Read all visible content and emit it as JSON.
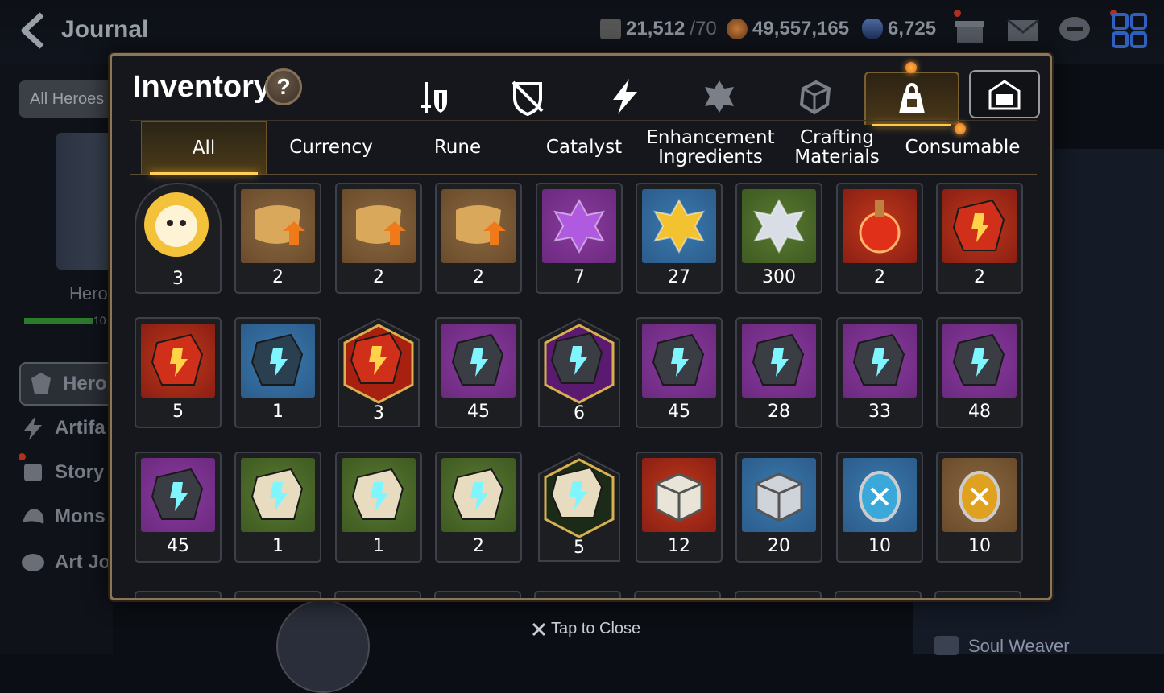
{
  "header": {
    "title": "Journal",
    "stamina": "21,512",
    "stamina_max": "/70",
    "gold": "49,557,165",
    "crystal": "6,725"
  },
  "left_nav": {
    "filter_label": "All Heroes",
    "hero_label": "Hero",
    "hero_progress": "10",
    "items": [
      {
        "label": "Hero",
        "icon": "hero-icon"
      },
      {
        "label": "Artifa",
        "icon": "lightning-icon"
      },
      {
        "label": "Story",
        "icon": "scroll-icon"
      },
      {
        "label": "Mons",
        "icon": "monster-icon"
      },
      {
        "label": "Art Jo",
        "icon": "palette-icon"
      }
    ]
  },
  "right_panel": {
    "item_label": "Soul Weaver"
  },
  "modal": {
    "title": "Inventory",
    "help_label": "?",
    "categories": [
      {
        "icon": "weapon-armor-icon"
      },
      {
        "icon": "broken-shield-icon"
      },
      {
        "icon": "lightning-icon"
      },
      {
        "icon": "rune-gear-icon"
      },
      {
        "icon": "material-cube-icon"
      },
      {
        "icon": "bag-icon",
        "active": true
      }
    ],
    "exchange_icon": "exchange-shop-icon",
    "subtabs": [
      "All",
      "Currency",
      "Rune",
      "Catalyst",
      "Enhancement\nIngredients",
      "Crafting\nMaterials",
      "Consumable"
    ],
    "active_subtab": "All",
    "items": [
      {
        "name": "phantasma-coin",
        "count": "3"
      },
      {
        "name": "rainbow-scroll",
        "count": "2"
      },
      {
        "name": "upgrade-scroll-a",
        "count": "2"
      },
      {
        "name": "upgrade-scroll-b",
        "count": "2"
      },
      {
        "name": "purple-crystal-flower",
        "count": "7"
      },
      {
        "name": "gold-crystal-flower",
        "count": "27"
      },
      {
        "name": "silver-crystal-flower",
        "count": "300"
      },
      {
        "name": "red-potion",
        "count": "2"
      },
      {
        "name": "red-stone-slash",
        "count": "2"
      },
      {
        "name": "red-stone-hammer",
        "count": "5"
      },
      {
        "name": "blue-rune-hammer",
        "count": "1"
      },
      {
        "name": "red-hex-stone-star",
        "count": "3"
      },
      {
        "name": "purple-stone-wing",
        "count": "45"
      },
      {
        "name": "purple-hex-stone-star",
        "count": "6"
      },
      {
        "name": "purple-stone-armor",
        "count": "45"
      },
      {
        "name": "purple-stone-slash",
        "count": "28"
      },
      {
        "name": "purple-stone-hammer",
        "count": "33"
      },
      {
        "name": "purple-stone-sword",
        "count": "48"
      },
      {
        "name": "purple-stone-boot",
        "count": "45"
      },
      {
        "name": "green-stone-wing",
        "count": "1"
      },
      {
        "name": "green-stone-sword",
        "count": "1"
      },
      {
        "name": "green-stone-helmet",
        "count": "2"
      },
      {
        "name": "green-hex-stone-star",
        "count": "5"
      },
      {
        "name": "gold-treasure-box",
        "count": "12"
      },
      {
        "name": "silver-treasure-box",
        "count": "20"
      },
      {
        "name": "blue-coin",
        "count": "10"
      },
      {
        "name": "gold-coin",
        "count": "10"
      }
    ],
    "close_label": "Tap to Close"
  },
  "colors": {
    "frame": "#8c7656",
    "accent_gold": "#ffc94a",
    "purple_bg": "#6b2a7e",
    "green_bg": "#3e5a22",
    "red_bg": "#8a1e14",
    "blue_bg": "#2c5c8a",
    "brown_bg": "#6a4a2a"
  }
}
